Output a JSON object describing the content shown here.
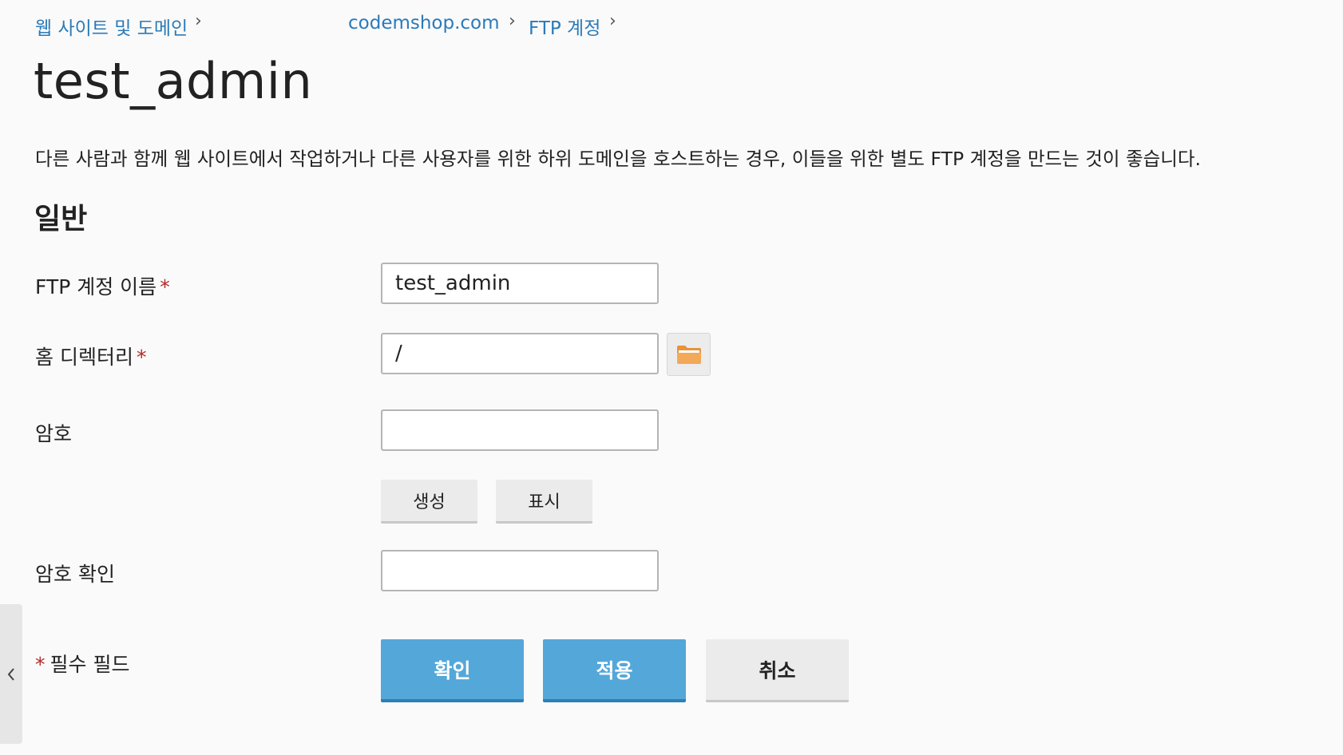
{
  "breadcrumb": {
    "items": [
      {
        "label": "웹 사이트 및 도메인"
      },
      {
        "label": "codemshop.com"
      },
      {
        "label": "FTP 계정"
      }
    ],
    "separator": "›"
  },
  "page": {
    "title": "test_admin",
    "description": "다른 사람과 함께 웹 사이트에서 작업하거나 다른 사용자를 위한 하위 도메인을 호스트하는 경우, 이들을 위한 별도 FTP 계정을 만드는 것이 좋습니다."
  },
  "form": {
    "section_title": "일반",
    "required_mark": "*",
    "fields": {
      "ftp_account_name": {
        "label": "FTP 계정 이름",
        "value": "test_admin"
      },
      "home_directory": {
        "label": "홈 디렉터리",
        "value": "/",
        "browse_icon": "folder-icon"
      },
      "password": {
        "label": "암호",
        "value": ""
      },
      "password_confirm": {
        "label": "암호 확인",
        "value": ""
      }
    },
    "password_buttons": {
      "generate": "생성",
      "show": "표시"
    },
    "required_note": "필수 필드",
    "actions": {
      "ok": "확인",
      "apply": "적용",
      "cancel": "취소"
    }
  },
  "side_toggle": {
    "icon": "chevron-left-icon"
  },
  "colors": {
    "link": "#2b7ab8",
    "required": "#b32a2a",
    "primary_button": "#54a7d9",
    "folder": "#f0a04b"
  }
}
